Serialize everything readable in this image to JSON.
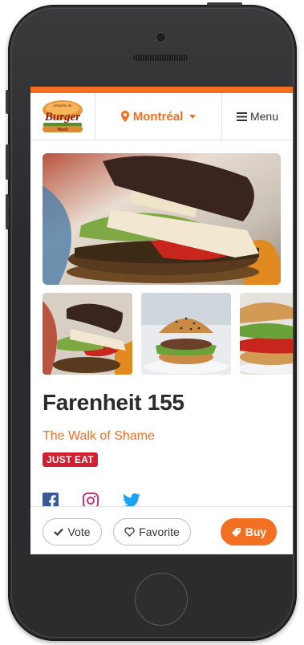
{
  "header": {
    "logo_top": "Semaine du",
    "logo_main": "Burger",
    "logo_bottom": "Week",
    "city": "Montréal",
    "menu_label": "Menu"
  },
  "restaurant": {
    "name": "Farenheit 155",
    "burger_name": "The Walk of Shame",
    "badge": "JUST EAT"
  },
  "social": [
    "facebook-icon",
    "instagram-icon",
    "twitter-icon"
  ],
  "actions": {
    "vote_label": "Vote",
    "favorite_label": "Favorite",
    "buy_label": "Buy"
  },
  "colors": {
    "accent": "#f36f21",
    "badge": "#d01f2f",
    "facebook": "#3b5998",
    "instagram": "#c13584",
    "twitter": "#1da1f2"
  }
}
